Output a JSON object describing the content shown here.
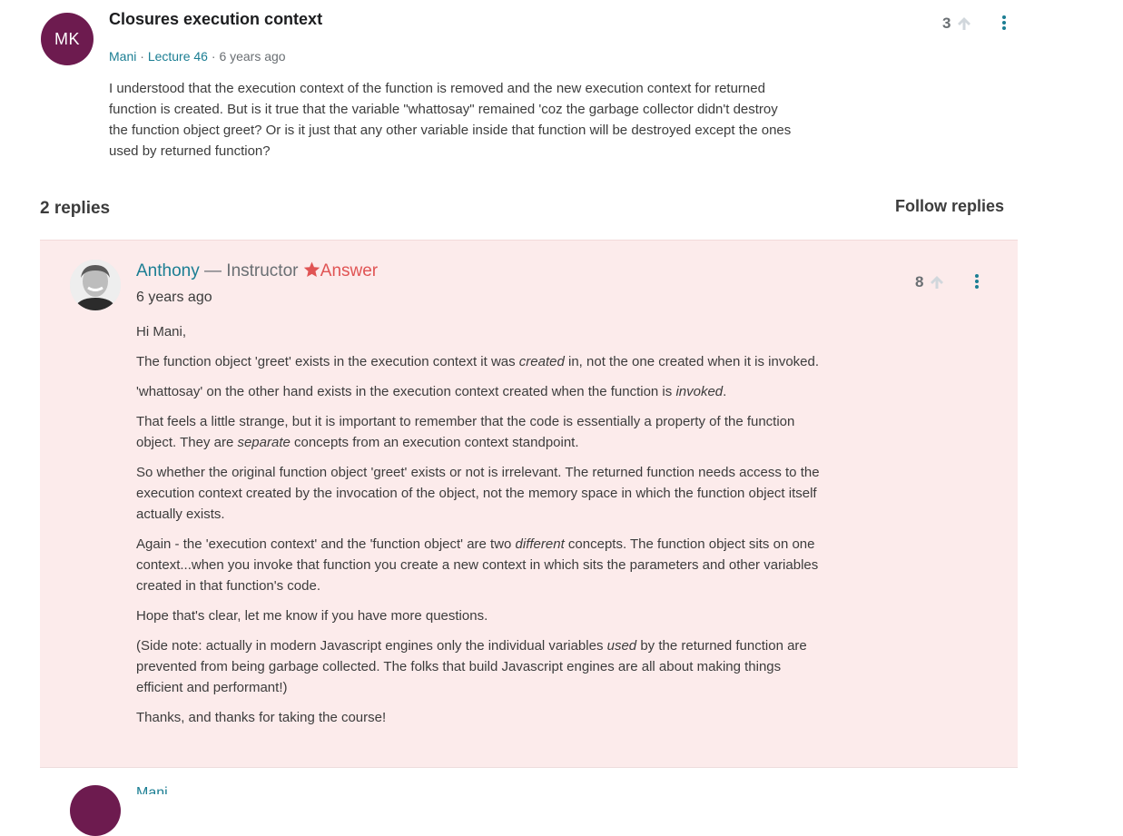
{
  "question": {
    "avatar_initials": "MK",
    "title": "Closures execution context",
    "author": "Mani",
    "lecture": "Lecture 46",
    "time": "6 years ago",
    "body": "I understood that the execution context of the function is removed and the new execution context for returned function is created. But is it true that the variable \"whattosay\" remained 'coz the garbage collector didn't destroy the function object greet? Or is it just that any other variable inside that function will be destroyed except the ones used by returned function?",
    "votes": "3"
  },
  "replies": {
    "count_label": "2 replies",
    "follow_label": "Follow replies"
  },
  "answer": {
    "author": "Anthony",
    "role": " — Instructor ",
    "badge": "Answer",
    "time": "6 years ago",
    "votes": "8",
    "greeting": "Hi Mani,",
    "p1_a": "The function object 'greet' exists in the execution context it was ",
    "p1_em": "created",
    "p1_b": " in, not the one created when it is invoked.",
    "p2_a": "'whattosay' on the other hand exists in the execution context created when the function is ",
    "p2_em": "invoked",
    "p2_b": ".",
    "p3_a": "That feels a little strange, but it is important to remember that the code is essentially a property of the function object. They are ",
    "p3_em": "separate",
    "p3_b": " concepts from an execution context standpoint.",
    "p4": "So whether the original function object 'greet' exists or not is irrelevant. The returned function needs access to the execution context created by the invocation of the object, not the memory space in which the function object itself actually exists.",
    "p5_a": "Again - the 'execution context' and the 'function object' are two ",
    "p5_em": "different",
    "p5_b": " concepts. The function object sits on one context...when you invoke that function you create a new context in which sits the parameters and other variables created in that function's code.",
    "p6": "Hope that's clear, let me know if you have more questions.",
    "p7_a": "(Side note: actually in modern Javascript engines only the individual variables ",
    "p7_em": "used",
    "p7_b": " by the returned function are prevented from being garbage collected. The folks that build Javascript engines are all about making things efficient and performant!)",
    "p8": "Thanks, and thanks for taking the course!"
  },
  "next_reply": {
    "author": "Mani"
  },
  "colors": {
    "avatar": "#6d1b4f",
    "link": "#1b7e93",
    "answer_bg": "#fcebeb",
    "answer_badge": "#e05454"
  },
  "icons": [
    "arrow-up-icon",
    "kebab-menu-icon",
    "star-icon"
  ]
}
